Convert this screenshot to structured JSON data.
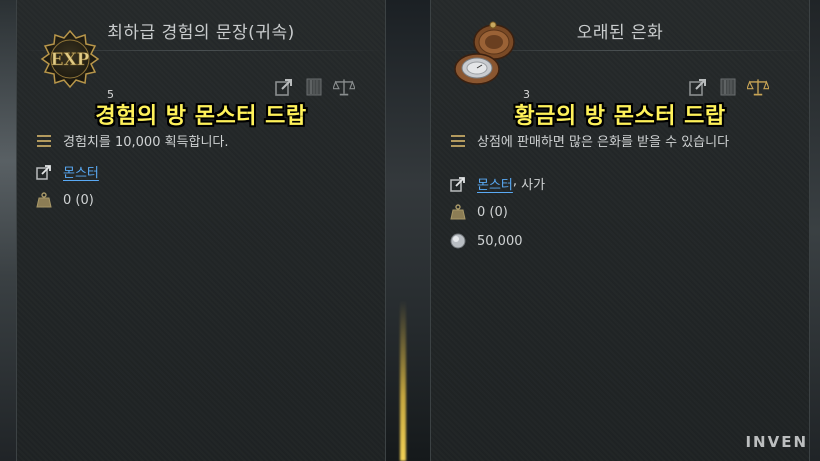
{
  "left_card": {
    "title": "최하급 경험의 문장(귀속)",
    "count": "5",
    "icon_text": "EXP",
    "banner": "경험의 방 몬스터 드랍",
    "description": "경험치를 10,000 획득합니다.",
    "source_link": "몬스터",
    "weight": "0 (0)"
  },
  "right_card": {
    "title": "오래된 은화",
    "count": "3",
    "banner": "황금의 방 몬스터 드랍",
    "description": "상점에 판매하면 많은 은화를 받을 수 있습니다",
    "source_link": "몬스터",
    "source_separator": ",",
    "source_extra": "사가",
    "weight": "0 (0)",
    "price": "50,000"
  },
  "icons": [
    "exp-item-icon",
    "pocket-watch-icon",
    "external-link-icon",
    "book-icon",
    "scales-icon",
    "list-icon",
    "weight-icon",
    "silver-coin-icon"
  ],
  "colors": {
    "banner": "#fff25a",
    "link": "#5aaaf5",
    "text": "#cfd2d3",
    "title": "#c9cccd"
  },
  "watermark": "INVEN"
}
